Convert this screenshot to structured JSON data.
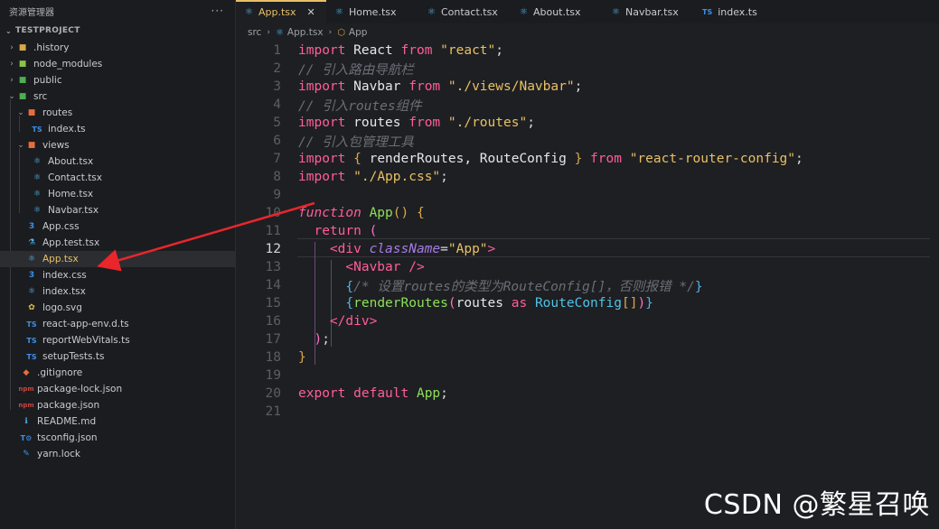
{
  "sidebar": {
    "title": "资源管理器",
    "more": "···",
    "project": "TESTPROJECT",
    "items": [
      {
        "label": ".history",
        "icon": "folder-icon"
      },
      {
        "label": "node_modules",
        "icon": "node-folder-icon"
      },
      {
        "label": "public",
        "icon": "public-folder-icon"
      },
      {
        "label": "src",
        "icon": "src-folder-icon"
      },
      {
        "label": "routes",
        "icon": "routes-folder-icon"
      },
      {
        "label": "index.ts",
        "icon": "ts-file-icon"
      },
      {
        "label": "views",
        "icon": "views-folder-icon"
      },
      {
        "label": "About.tsx",
        "icon": "react-file-icon"
      },
      {
        "label": "Contact.tsx",
        "icon": "react-file-icon"
      },
      {
        "label": "Home.tsx",
        "icon": "react-file-icon"
      },
      {
        "label": "Navbar.tsx",
        "icon": "react-file-icon"
      },
      {
        "label": "App.css",
        "icon": "css-file-icon"
      },
      {
        "label": "App.test.tsx",
        "icon": "test-file-icon"
      },
      {
        "label": "App.tsx",
        "icon": "react-file-icon"
      },
      {
        "label": "index.css",
        "icon": "css-file-icon"
      },
      {
        "label": "index.tsx",
        "icon": "react-file-icon"
      },
      {
        "label": "logo.svg",
        "icon": "svg-file-icon"
      },
      {
        "label": "react-app-env.d.ts",
        "icon": "ts-file-icon"
      },
      {
        "label": "reportWebVitals.ts",
        "icon": "ts-file-icon"
      },
      {
        "label": "setupTests.ts",
        "icon": "ts-file-icon"
      },
      {
        "label": ".gitignore",
        "icon": "git-file-icon"
      },
      {
        "label": "package-lock.json",
        "icon": "json-file-icon"
      },
      {
        "label": "package.json",
        "icon": "json-file-icon"
      },
      {
        "label": "README.md",
        "icon": "readme-file-icon"
      },
      {
        "label": "tsconfig.json",
        "icon": "tsconfig-file-icon"
      },
      {
        "label": "yarn.lock",
        "icon": "yarn-file-icon"
      }
    ]
  },
  "tabs": [
    {
      "label": "App.tsx",
      "close": "✕"
    },
    {
      "label": "Home.tsx"
    },
    {
      "label": "Contact.tsx"
    },
    {
      "label": "About.tsx"
    },
    {
      "label": "Navbar.tsx"
    },
    {
      "label": "index.ts"
    }
  ],
  "breadcrumb": {
    "a": "src",
    "b": "App.tsx",
    "c": "App"
  },
  "editor": {
    "line_numbers": [
      "1",
      "2",
      "3",
      "4",
      "5",
      "6",
      "7",
      "8",
      "9",
      "10",
      "11",
      "12",
      "13",
      "14",
      "15",
      "16",
      "17",
      "18",
      "19",
      "20",
      "21"
    ]
  },
  "watermark": "CSDN @繁星召唤",
  "colors": {
    "accent": "#e8c065",
    "arrow": "#e8262c",
    "keyword": "#ff5e9a",
    "string": "#e8c065",
    "comment": "#6a6e76",
    "function": "#8de05a"
  }
}
